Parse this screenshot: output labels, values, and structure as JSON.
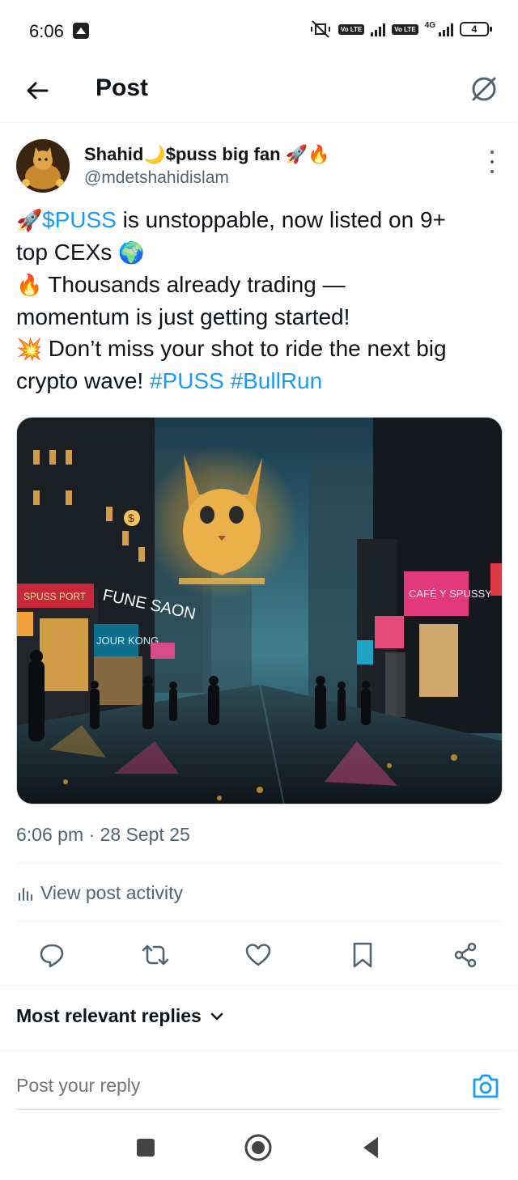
{
  "status_bar": {
    "time": "6:06",
    "network": "4G",
    "volte_label": "Vo LTE",
    "battery": "4"
  },
  "header": {
    "title": "Post"
  },
  "post": {
    "author_name": "Shahid🌙$puss big fan 🚀🔥",
    "author_handle": "@mdetshahidislam",
    "text_lines": [
      [
        "🚀",
        " ",
        "$PUSS",
        " is unstoppable, now listed on 9+"
      ],
      [
        "top CEXs ",
        "🌍"
      ],
      [
        "🔥",
        " Thousands already trading —"
      ],
      [
        "momentum is just getting started!"
      ],
      [
        "💥",
        " Don’t miss your shot to ride the next big"
      ],
      [
        "crypto wave! ",
        "#PUSS",
        " ",
        "#BullRun"
      ]
    ],
    "line1_cashtag": "$PUSS",
    "line1_rest": " is unstoppable, now listed on 9+",
    "line2": "top CEXs ",
    "line3": " Thousands already trading —",
    "line4": "momentum is just getting started!",
    "line5": " Don’t miss your shot to ride the next big",
    "line6": "crypto wave! ",
    "hashtag1": "#PUSS",
    "hashtag2": "#BullRun",
    "emoji_rocket": "🚀",
    "emoji_globe": "🌍",
    "emoji_fire": "🔥",
    "emoji_boom": "💥",
    "image_signs": {
      "left_sign": "SPUSS PORT",
      "mid_sign": "FUNE SAON",
      "blue_sign": "JOUR KONG",
      "pink_sign": "CAFÉ Y SPUSSY",
      "dollar": "$"
    },
    "timestamp": "6:06 pm · 28 Sept 25",
    "activity_label": "View post activity"
  },
  "replies": {
    "sort_label": "Most relevant replies",
    "placeholder": "Post your reply"
  },
  "colors": {
    "accent": "#1d9bf0",
    "text_primary": "#0f1419",
    "text_secondary": "#536471"
  }
}
